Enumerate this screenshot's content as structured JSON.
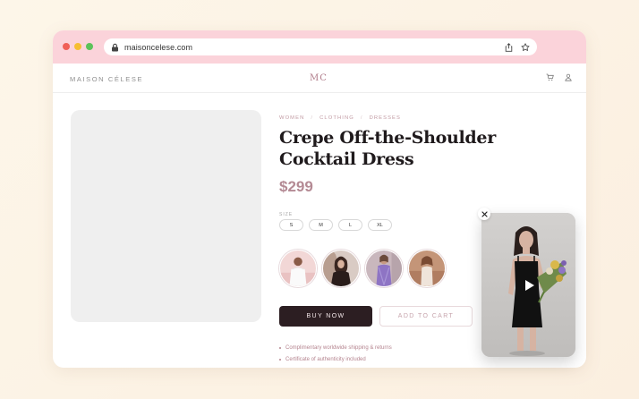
{
  "browser": {
    "url": "maisoncelese.com"
  },
  "site": {
    "brand": "MAISON CÉLESE",
    "monogram": "MC"
  },
  "product": {
    "breadcrumb": [
      "WOMEN",
      "CLOTHING",
      "DRESSES"
    ],
    "breadcrumb_separator": "/",
    "title": "Crepe Off-the-Shoulder Cocktail Dress",
    "price": "$299",
    "size_label": "SIZE",
    "sizes": [
      "S",
      "M",
      "L",
      "XL"
    ],
    "buy_label": "BUY NOW",
    "cart_label": "ADD TO CART",
    "features": [
      "Complimentary worldwide shipping & returns",
      "Certificate of authenticity included"
    ]
  },
  "colors": {
    "chrome": "#fbd3da",
    "accent": "#b48a94",
    "buy_button": "#2c1e22"
  },
  "icons": {
    "lock": "lock-icon",
    "share": "share-icon",
    "bookmark": "star-icon",
    "cart": "cart-icon",
    "account": "user-icon",
    "close": "close-icon",
    "play": "play-icon"
  }
}
